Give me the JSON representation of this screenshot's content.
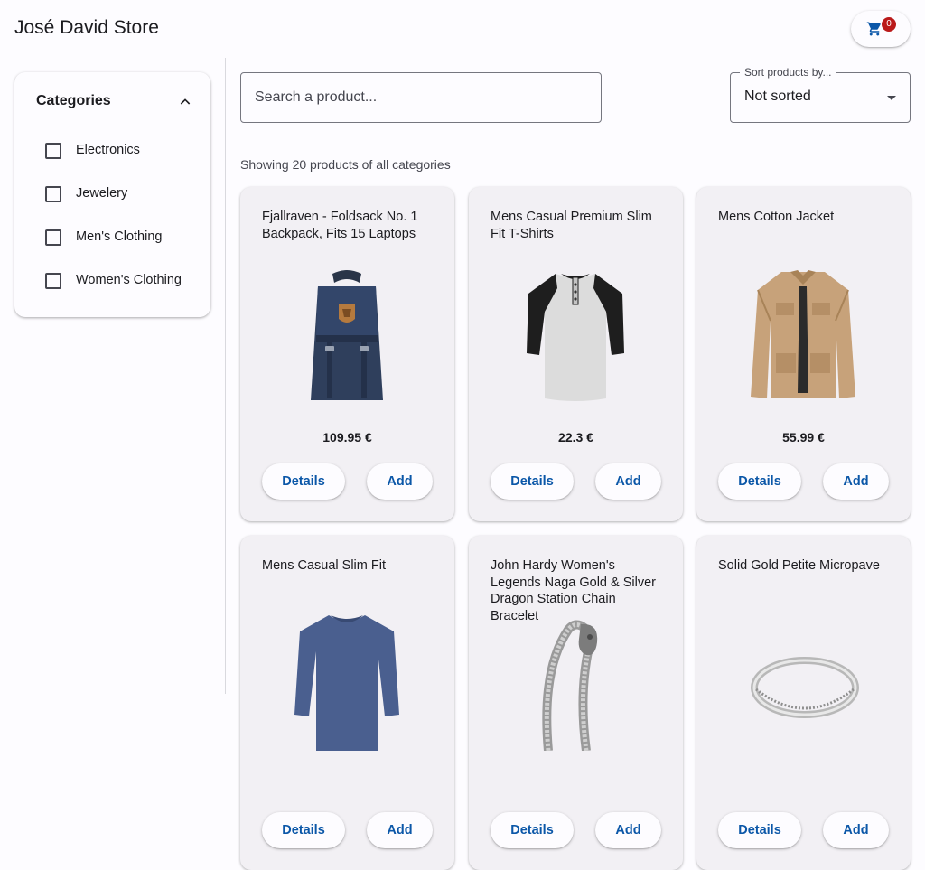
{
  "header": {
    "title": "José David Store",
    "cart_count": "0"
  },
  "filters": {
    "title": "Categories",
    "items": [
      "Electronics",
      "Jewelery",
      "Men's Clothing",
      "Women's Clothing"
    ]
  },
  "search": {
    "placeholder": "Search a product..."
  },
  "sort": {
    "label": "Sort products by...",
    "value": "Not sorted"
  },
  "summary": "Showing 20 products of all categories",
  "buttons": {
    "details": "Details",
    "add": "Add"
  },
  "products": [
    {
      "title": "Fjallraven - Foldsack No. 1 Backpack, Fits 15 Laptops",
      "price": "109.95 €",
      "image": "backpack"
    },
    {
      "title": "Mens Casual Premium Slim Fit T-Shirts",
      "price": "22.3 €",
      "image": "raglan-shirt"
    },
    {
      "title": "Mens Cotton Jacket",
      "price": "55.99 €",
      "image": "jacket"
    },
    {
      "title": "Mens Casual Slim Fit",
      "image": "long-sleeve-shirt"
    },
    {
      "title": "John Hardy Women's Legends Naga Gold & Silver Dragon Station Chain Bracelet",
      "image": "bracelet"
    },
    {
      "title": "Solid Gold Petite Micropave",
      "image": "ring"
    }
  ],
  "colors": {
    "accent": "#0b57a8",
    "badge": "#ba1a1a",
    "card_bg": "#f2f0f4"
  }
}
